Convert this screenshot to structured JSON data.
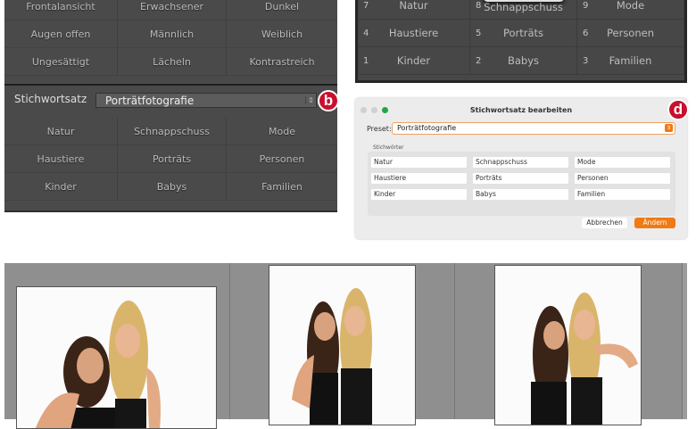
{
  "left_panel": {
    "top_keywords": [
      "Frontalansicht",
      "Erwachsener",
      "Dunkel",
      "Augen offen",
      "Männlich",
      "Weiblich",
      "Ungesättigt",
      "Lächeln",
      "Kontrastreich"
    ],
    "set_label": "Stichwortsatz",
    "set_value": "Porträtfotografie",
    "keywords": [
      "Natur",
      "Schnappschuss",
      "Mode",
      "Haustiere",
      "Porträts",
      "Personen",
      "Kinder",
      "Babys",
      "Familien"
    ],
    "badge": "b"
  },
  "right_panel": {
    "cells": [
      {
        "num": "7",
        "kw": "Natur"
      },
      {
        "num": "8",
        "kw": "Schnappschuss"
      },
      {
        "num": "9",
        "kw": "Mode"
      },
      {
        "num": "4",
        "kw": "Haustiere"
      },
      {
        "num": "5",
        "kw": "Porträts"
      },
      {
        "num": "6",
        "kw": "Personen"
      },
      {
        "num": "1",
        "kw": "Kinder"
      },
      {
        "num": "2",
        "kw": "Babys"
      },
      {
        "num": "3",
        "kw": "Familien"
      }
    ]
  },
  "dialog": {
    "title": "Stichwortsatz bearbeiten",
    "preset_label": "Preset:",
    "preset_value": "Porträtfotografie",
    "section_label": "Stichwörter",
    "fields": [
      "Natur",
      "Schnappschuss",
      "Mode",
      "Haustiere",
      "Porträts",
      "Personen",
      "Kinder",
      "Babys",
      "Familien"
    ],
    "cancel": "Abbrechen",
    "ok": "Ändern",
    "badge": "d",
    "accent": "#f07a14"
  }
}
